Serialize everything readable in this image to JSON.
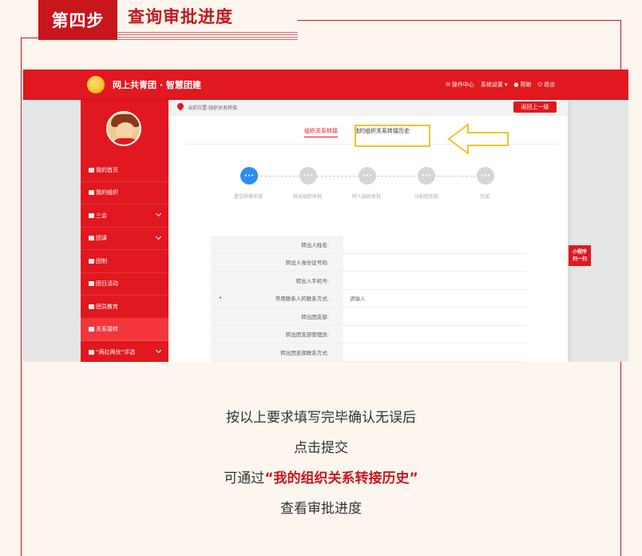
{
  "step": {
    "badge": "第四步",
    "title": "查询审批进度"
  },
  "screenshot": {
    "topbar": {
      "logo_text": "网上共青团 · 智慧团建",
      "nav": [
        "操作中心",
        "系统设置",
        "帮助",
        "退出"
      ]
    },
    "sidebar": {
      "items": [
        {
          "label": "我的首页",
          "expandable": false,
          "active": false
        },
        {
          "label": "我的组织",
          "expandable": false,
          "active": false
        },
        {
          "label": "三会",
          "expandable": true,
          "active": false
        },
        {
          "label": "团课",
          "expandable": true,
          "active": false
        },
        {
          "label": "团制",
          "expandable": false,
          "active": false
        },
        {
          "label": "团日活动",
          "expandable": false,
          "active": false
        },
        {
          "label": "团员教育",
          "expandable": false,
          "active": false
        },
        {
          "label": "关系接转",
          "expandable": false,
          "active": true
        },
        {
          "label": "“两红两优”评选",
          "expandable": true,
          "active": false
        }
      ]
    },
    "breadcrumb": "当前位置:组织关系转接",
    "back_button": "返回上一级",
    "tabs": [
      "组织关系转接",
      "我的组织关系转接历史"
    ],
    "steps": [
      "提交转接申请",
      "转出组织审批",
      "转入组织审批",
      "分配团支部",
      "完成"
    ],
    "step_dot_text": "•••",
    "form_rows": [
      {
        "label": "转出人姓名:",
        "value": "",
        "required": false
      },
      {
        "label": "转出人身份证号码:",
        "value": "",
        "required": false
      },
      {
        "label": "转出人手机号:",
        "value": "",
        "required": false
      },
      {
        "label": "常用联系人的联系方式:",
        "value": "请输入",
        "required": true
      },
      {
        "label": "转出团支部:",
        "value": "",
        "required": false
      },
      {
        "label": "转出团支部管理员:",
        "value": "",
        "required": false
      },
      {
        "label": "转出团支部联系方式:",
        "value": "",
        "required": false
      }
    ],
    "required_mark": "•",
    "mini_program": [
      "小程序",
      "扫一扫"
    ]
  },
  "caption": {
    "line1": "按以上要求填写完毕确认无误后",
    "line2": "点击提交",
    "line3_prefix": "可通过",
    "line3_highlight": "“我的组织关系转接历史”",
    "line4": "查看审批进度"
  },
  "colors": {
    "brand_red": "#c9161d",
    "ui_red": "#e1181f",
    "highlight_yellow": "#f2c429",
    "step_active": "#2d8cf0"
  }
}
